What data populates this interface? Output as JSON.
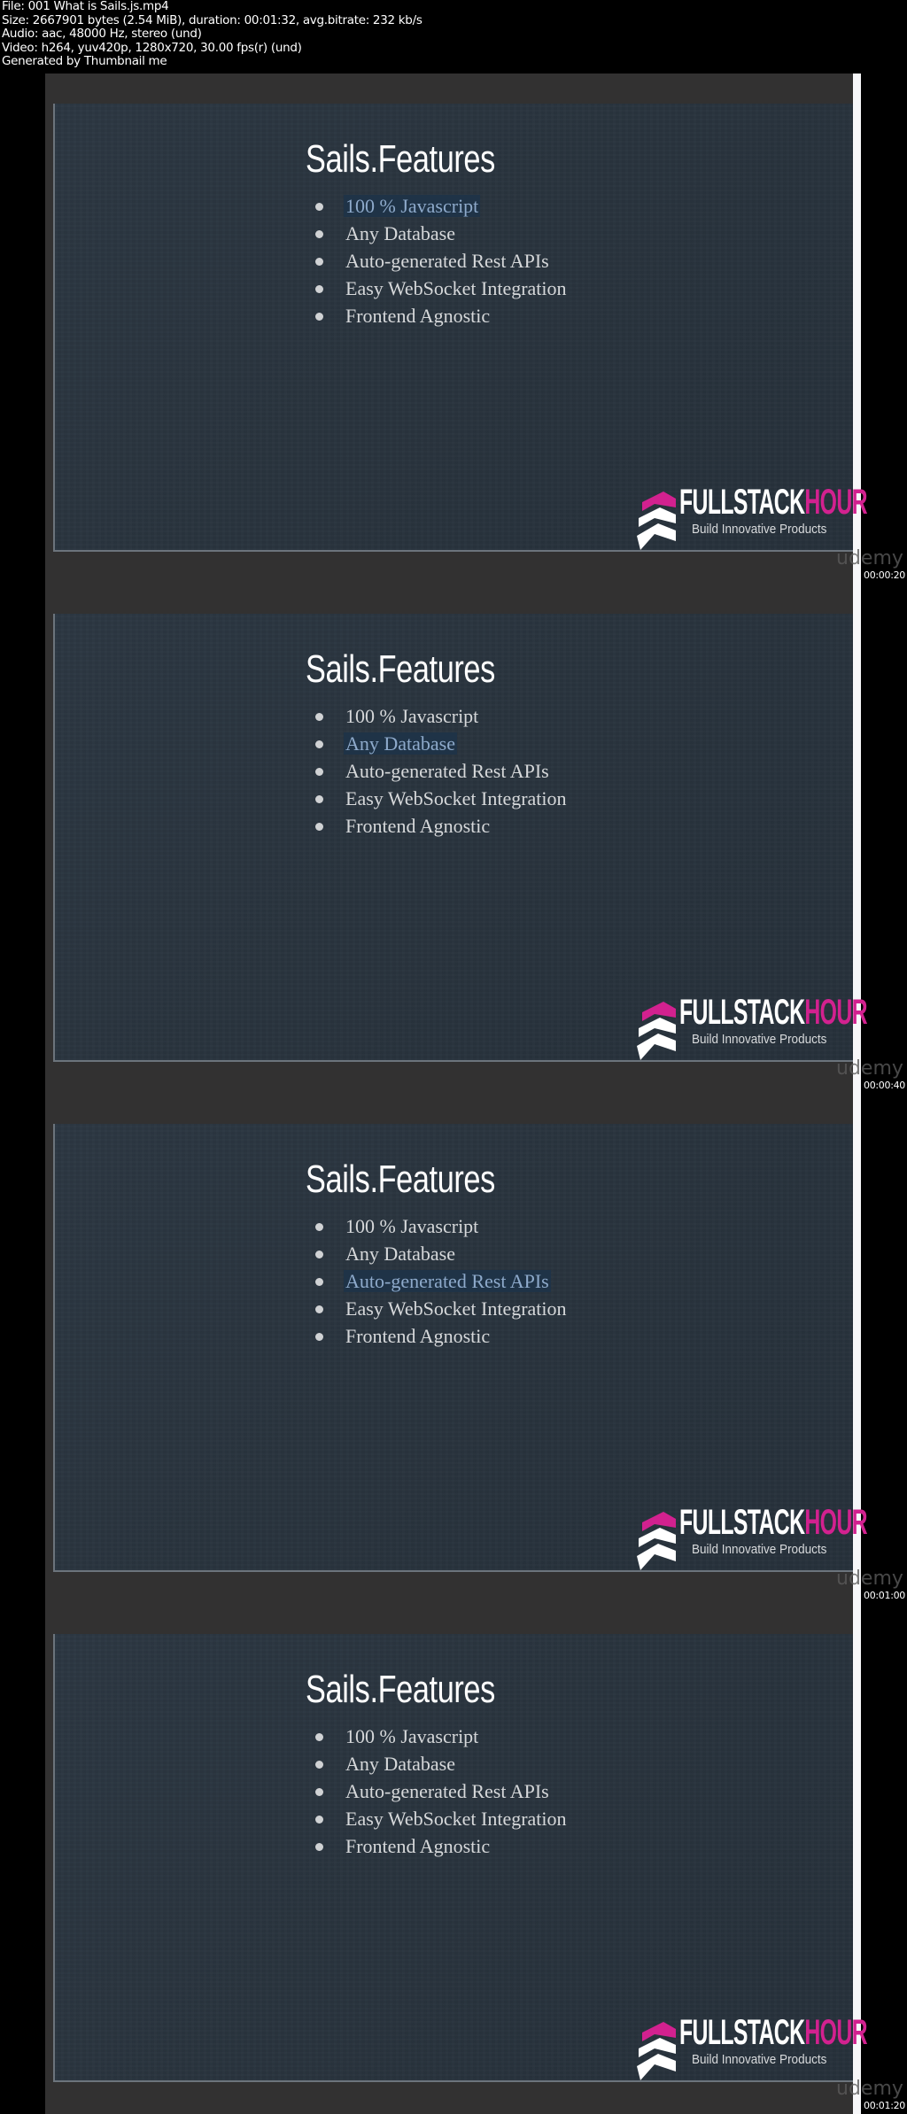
{
  "header": {
    "lines": [
      "File: 001 What is Sails.js.mp4",
      "Size: 2667901 bytes (2.54 MiB), duration: 00:01:32, avg.bitrate: 232 kb/s",
      "Audio: aac, 48000 Hz, stereo (und)",
      "Video: h264, yuv420p, 1280x720, 30.00 fps(r) (und)",
      "Generated by Thumbnail me"
    ]
  },
  "slide": {
    "title": "Sails.Features",
    "items": [
      "100 % Javascript",
      "Any Database",
      "Auto-generated Rest APIs",
      "Easy WebSocket Integration",
      "Frontend Agnostic"
    ],
    "logo": {
      "word_a": "FULLSTACK",
      "word_b": "HOUR",
      "tagline": "Build Innovative Products"
    },
    "watermark": "udemy"
  },
  "colors": {
    "slide_bg": "#29343e",
    "brand_pink": "#d2218f",
    "highlight_text": "#8eaacb",
    "highlight_bg": "#1f3347"
  },
  "frames": [
    {
      "timestamp": "00:00:20",
      "highlighted_index": 0
    },
    {
      "timestamp": "00:00:40",
      "highlighted_index": 1
    },
    {
      "timestamp": "00:01:00",
      "highlighted_index": 2
    },
    {
      "timestamp": "00:01:20",
      "highlighted_index": -1
    }
  ]
}
